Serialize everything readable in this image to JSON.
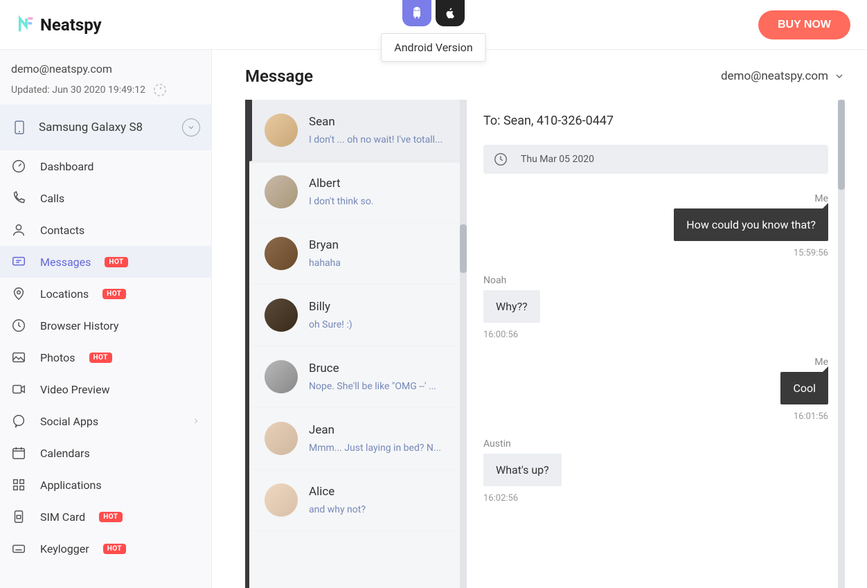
{
  "header": {
    "brand": "Neatspy",
    "tooltip": "Android Version",
    "buy": "BUY NOW"
  },
  "account": {
    "email": "demo@neatspy.com",
    "updated": "Updated: Jun 30 2020 19:49:12",
    "device": "Samsung Galaxy S8"
  },
  "nav": [
    {
      "label": "Dashboard",
      "icon": "gauge",
      "hot": false
    },
    {
      "label": "Calls",
      "icon": "phone",
      "hot": false
    },
    {
      "label": "Contacts",
      "icon": "person",
      "hot": false
    },
    {
      "label": "Messages",
      "icon": "message",
      "hot": true,
      "active": true
    },
    {
      "label": "Locations",
      "icon": "pin",
      "hot": true
    },
    {
      "label": "Browser History",
      "icon": "clock",
      "hot": false
    },
    {
      "label": "Photos",
      "icon": "image",
      "hot": true
    },
    {
      "label": "Video Preview",
      "icon": "video",
      "hot": false
    },
    {
      "label": "Social Apps",
      "icon": "chat",
      "hot": false,
      "chevron": true
    },
    {
      "label": "Calendars",
      "icon": "calendar",
      "hot": false
    },
    {
      "label": "Applications",
      "icon": "grid",
      "hot": false
    },
    {
      "label": "SIM Card",
      "icon": "sim",
      "hot": true
    },
    {
      "label": "Keylogger",
      "icon": "keyboard",
      "hot": true
    }
  ],
  "hot_label": "HOT",
  "page": {
    "title": "Message",
    "header_email": "demo@neatspy.com"
  },
  "conversations": [
    {
      "name": "Sean",
      "preview": "I don't ... oh no wait! I've totall...",
      "selected": true
    },
    {
      "name": "Albert",
      "preview": "I don't think so."
    },
    {
      "name": "Bryan",
      "preview": "hahaha"
    },
    {
      "name": "Billy",
      "preview": "oh Sure! :)"
    },
    {
      "name": "Bruce",
      "preview": "Nope. She'll be like \"OMG --' ..."
    },
    {
      "name": "Jean",
      "preview": "Mmm... Just laying in bed? N..."
    },
    {
      "name": "Alice",
      "preview": "and why not?"
    }
  ],
  "thread": {
    "to": "To: Sean, 410-326-0447",
    "date": "Thu Mar 05 2020",
    "messages": [
      {
        "sender": "Me",
        "side": "me",
        "text": "How could you know that?",
        "time": "15:59:56"
      },
      {
        "sender": "Noah",
        "side": "them",
        "text": "Why??",
        "time": "16:00:56"
      },
      {
        "sender": "Me",
        "side": "me",
        "text": "Cool",
        "time": "16:01:56"
      },
      {
        "sender": "Austin",
        "side": "them",
        "text": "What's up?",
        "time": "16:02:56"
      }
    ]
  }
}
